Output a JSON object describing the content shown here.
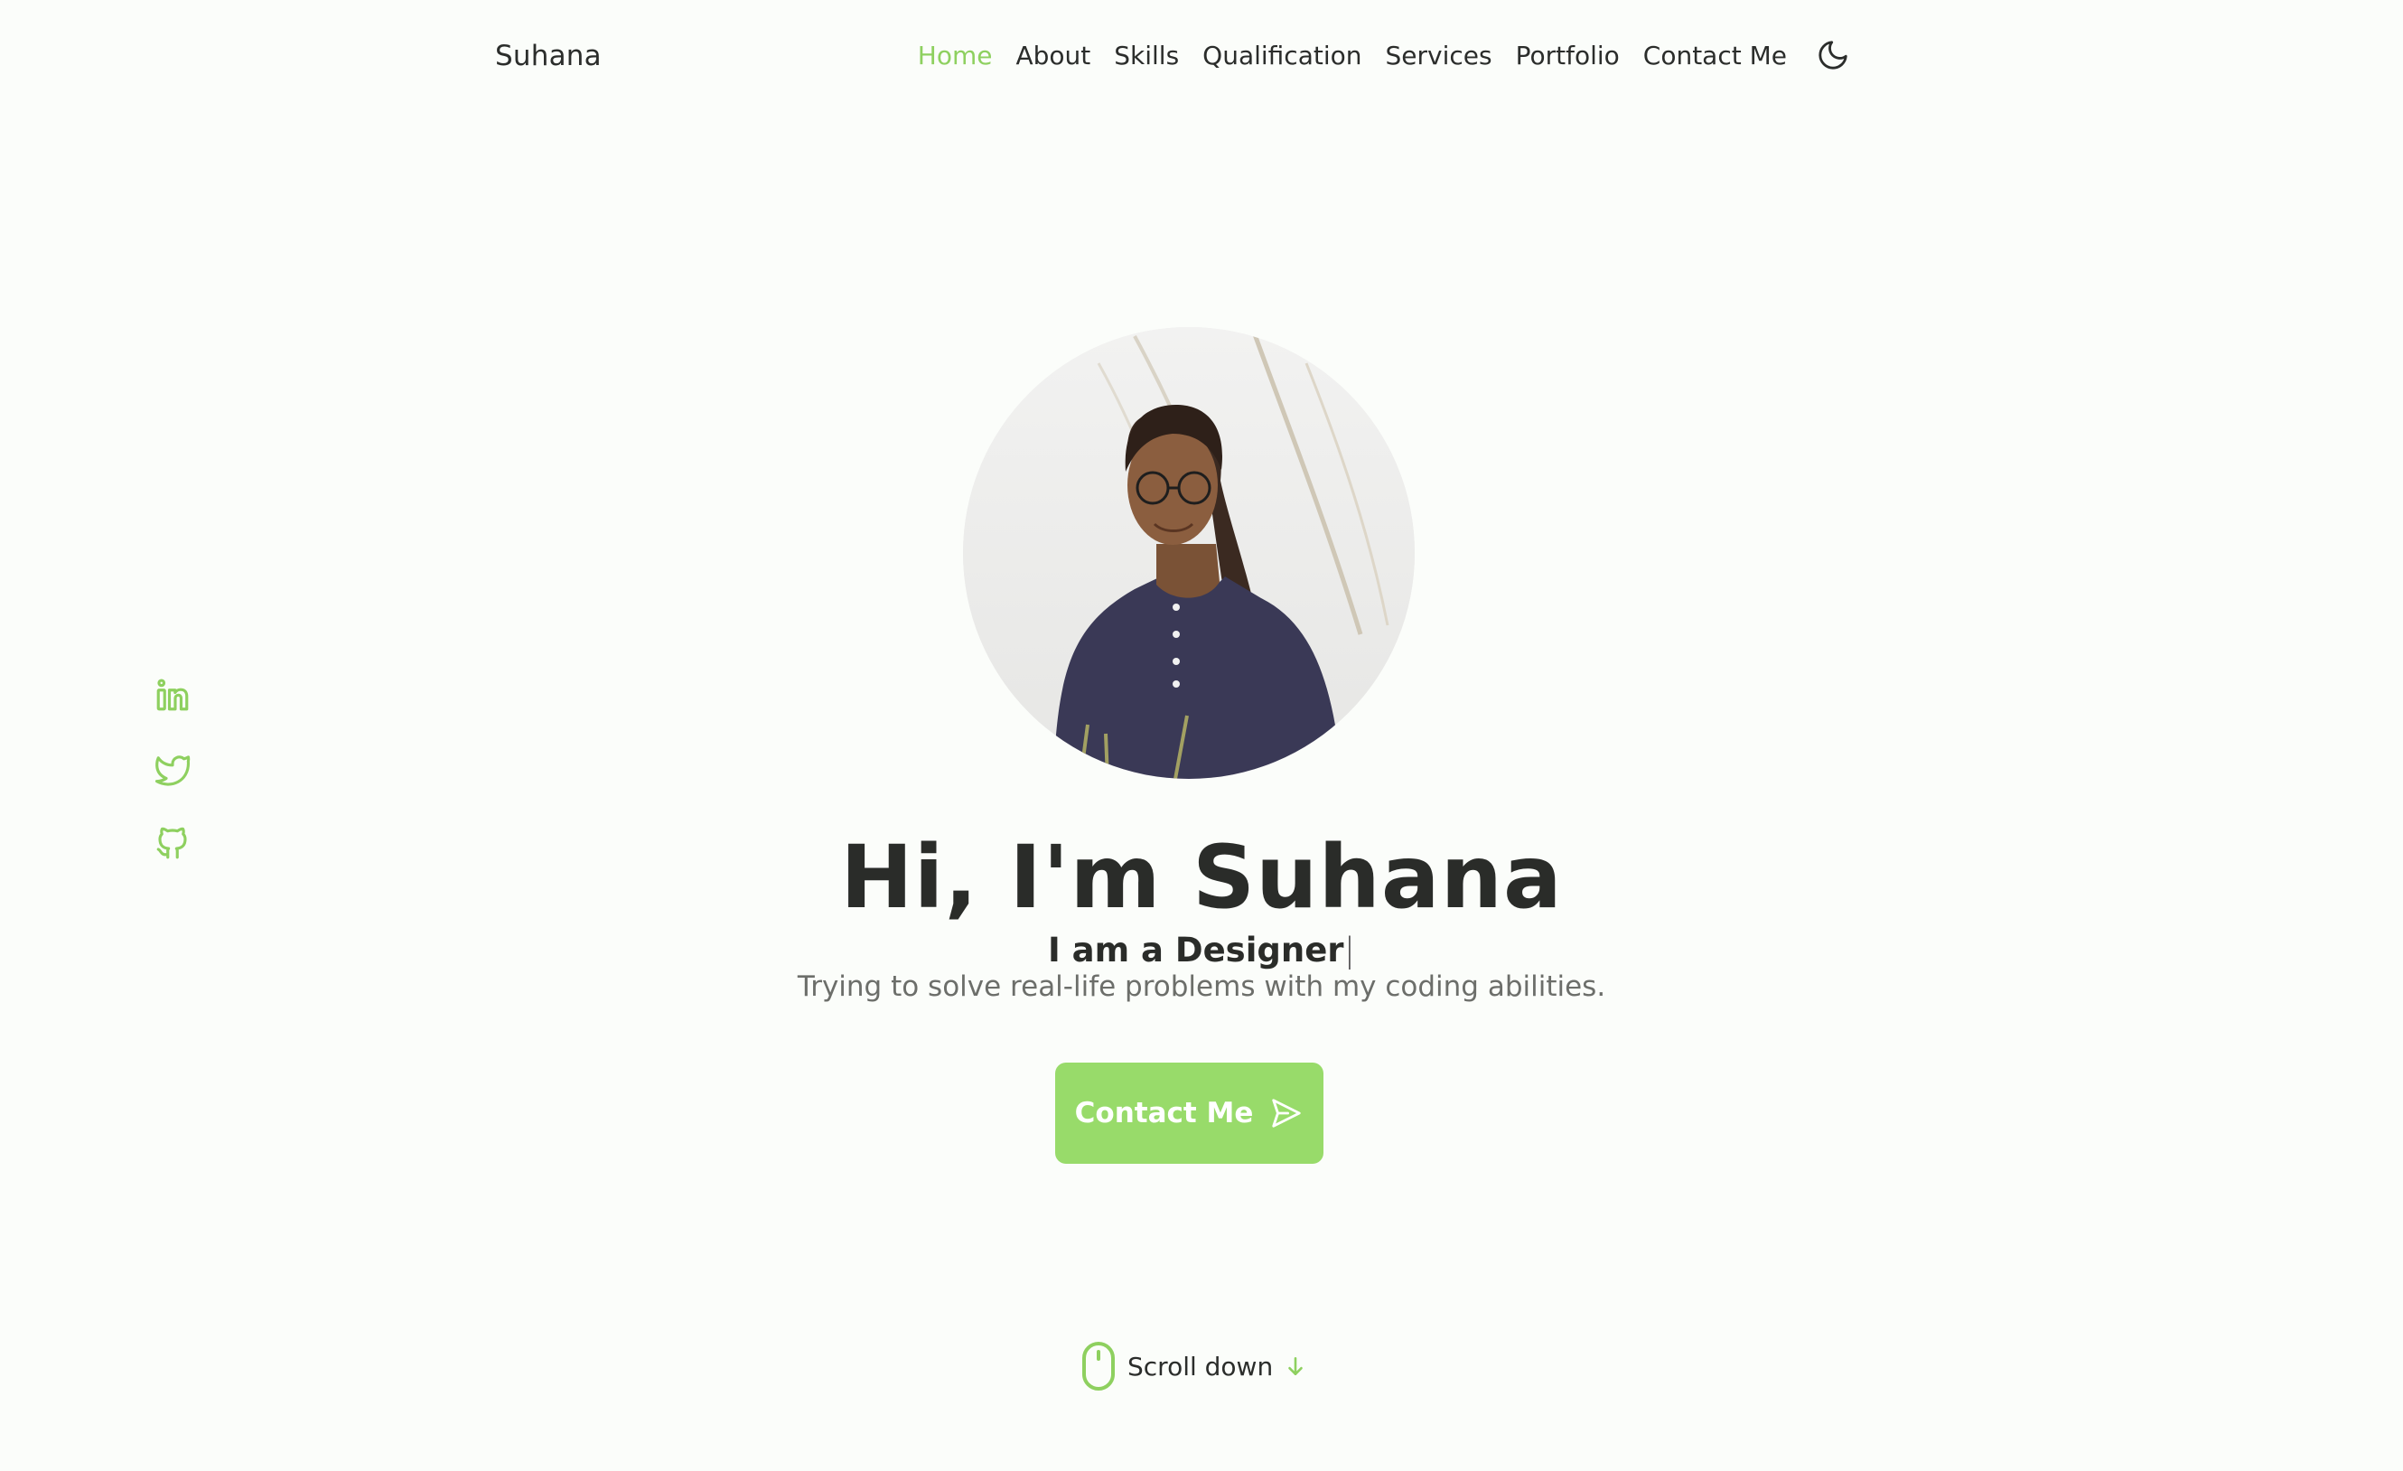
{
  "header": {
    "brand": "Suhana",
    "nav": [
      {
        "label": "Home",
        "active": true
      },
      {
        "label": "About",
        "active": false
      },
      {
        "label": "Skills",
        "active": false
      },
      {
        "label": "Qualification",
        "active": false
      },
      {
        "label": "Services",
        "active": false
      },
      {
        "label": "Portfolio",
        "active": false
      },
      {
        "label": "Contact Me",
        "active": false
      }
    ],
    "theme_toggle_icon": "moon-icon"
  },
  "social": [
    {
      "icon": "linkedin-icon"
    },
    {
      "icon": "twitter-icon"
    },
    {
      "icon": "github-icon"
    }
  ],
  "hero": {
    "title": "Hi, I'm Suhana",
    "subtitle": "I am a Designer",
    "description": "Trying to solve real-life problems with my coding abilities.",
    "cta_label": "Contact Me",
    "cta_icon": "send-icon",
    "scroll_label": "Scroll down"
  },
  "colors": {
    "accent": "#8ed05f",
    "button": "#98db6a",
    "background": "#fbfdfa",
    "text": "#2b2d2b",
    "muted": "#6c6e6a"
  }
}
